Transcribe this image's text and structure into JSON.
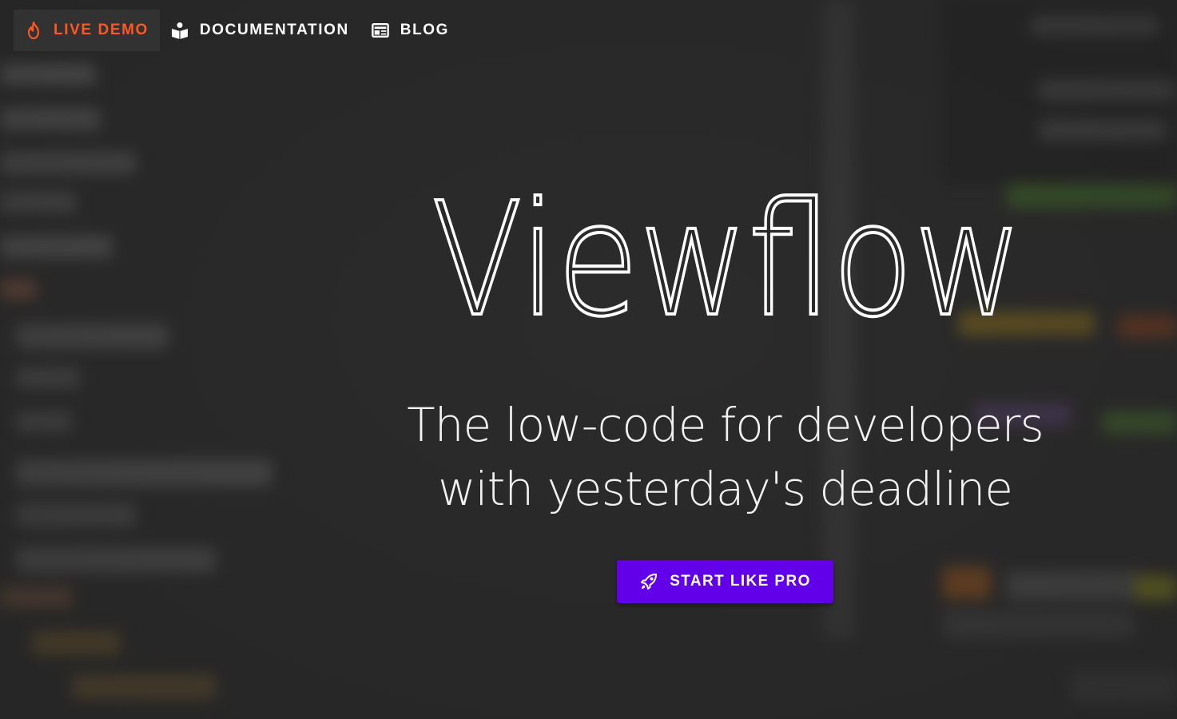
{
  "nav": {
    "items": [
      {
        "label": "LIVE DEMO",
        "icon": "fire-icon",
        "active": true
      },
      {
        "label": "DOCUMENTATION",
        "icon": "book-reader-icon",
        "active": false
      },
      {
        "label": "BLOG",
        "icon": "newspaper-icon",
        "active": false
      }
    ]
  },
  "hero": {
    "title": "Viewflow",
    "subtitle_line1": "The low-code for developers",
    "subtitle_line2": "with yesterday's deadline",
    "cta_label": "START LIKE PRO",
    "cta_icon": "rocket-icon"
  },
  "colors": {
    "accent": "#ff5722",
    "cta": "#6200ea",
    "background": "#2d2c2c"
  }
}
